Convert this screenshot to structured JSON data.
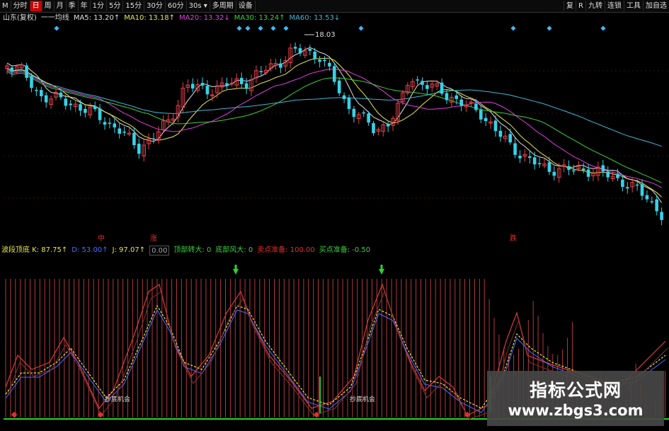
{
  "toolbar": {
    "left": [
      {
        "label": "M",
        "active": false
      },
      {
        "label": "分时",
        "active": false
      },
      {
        "label": "日",
        "active": true
      },
      {
        "label": "周",
        "active": false
      },
      {
        "label": "月",
        "active": false
      },
      {
        "label": "季",
        "active": false
      },
      {
        "label": "年",
        "active": false
      },
      {
        "label": "1分",
        "active": false
      },
      {
        "label": "5分",
        "active": false
      },
      {
        "label": "15分",
        "active": false
      },
      {
        "label": "30分",
        "active": false
      },
      {
        "label": "60分",
        "active": false
      },
      {
        "label": "30s ▾",
        "active": false
      },
      {
        "label": "多周期",
        "active": false
      },
      {
        "label": "设备",
        "active": false
      }
    ],
    "right": [
      "复",
      "R",
      "九转",
      "连锁",
      "工具",
      "加自选"
    ]
  },
  "ma_legend": [
    {
      "label": "山东(复权)",
      "color": "#dddddd"
    },
    {
      "label": "一一均线",
      "color": "#dddddd"
    },
    {
      "label": "MA5: 13.20↑",
      "color": "#e0e0e0"
    },
    {
      "label": "MA10: 13.18↑",
      "color": "#e8e84a"
    },
    {
      "label": "MA20: 13.32↓",
      "color": "#e040e0"
    },
    {
      "label": "MA30: 13.24↑",
      "color": "#3ecf3e"
    },
    {
      "label": "MA60: 13.53↓",
      "color": "#3fb8d8"
    }
  ],
  "price_label": "18.03",
  "markers": {
    "left": "中",
    "middle": "涨",
    "right": "跌"
  },
  "indicator_legend": [
    {
      "label": "波段顶底 K: 87.75↑",
      "color": "#e8e84a",
      "boxed": false
    },
    {
      "label": "D: 53.00↑",
      "color": "#4f6cff",
      "boxed": false
    },
    {
      "label": "J: 97.07↑",
      "color": "#e8e84a",
      "boxed": false
    },
    {
      "label": "0.00",
      "color": "#aaaaaa",
      "boxed": true
    },
    {
      "label": "顶部转大: 0",
      "color": "#3ecf3e",
      "boxed": false
    },
    {
      "label": "底部风大: 0",
      "color": "#3ecf3e",
      "boxed": false
    },
    {
      "label": "卖点准备: 100.00",
      "color": "#e03030",
      "boxed": false
    },
    {
      "label": "买点准备: -0.50",
      "color": "#3ecf3e",
      "boxed": false
    }
  ],
  "annotations": [
    "抄底机会",
    "抄底机会"
  ],
  "watermark": {
    "title": "指标公式网",
    "url": "www.zbgs3.com"
  },
  "colors": {
    "up": "#e8404a",
    "down": "#35d3e8",
    "ma5": "#e0e0e0",
    "ma10": "#e8e84a",
    "ma20": "#e040e0",
    "ma30": "#3ecf3e",
    "ma60": "#3fb8d8",
    "osc_bar": "#b33a3a",
    "baseline": "#2ad42a"
  }
}
